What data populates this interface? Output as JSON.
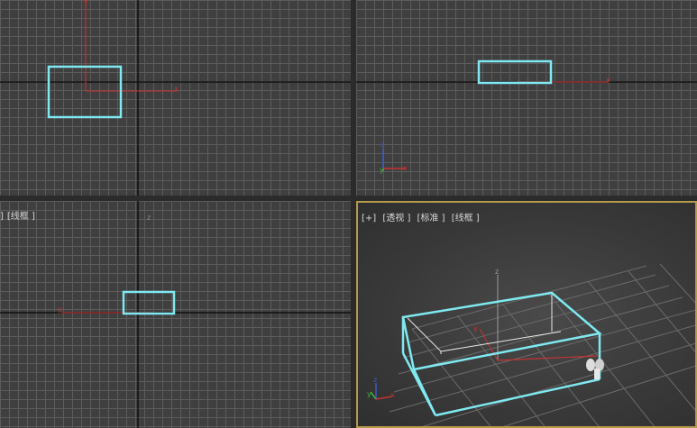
{
  "viewports": {
    "bottom_left": {
      "labels": [
        "]",
        "[线框 ]"
      ]
    },
    "perspective": {
      "labels": [
        "[+]",
        "[透视 ]",
        "[标准 ]",
        "[线框 ]"
      ]
    }
  },
  "axes": {
    "x": "x",
    "y": "y",
    "z": "z"
  },
  "colors": {
    "viewport_bg": "#3f3f3f",
    "grid": "#5c5c5c",
    "selection": "#7fe8f0",
    "axis_x": "#c83232",
    "axis_y": "#3cb43c",
    "axis_z": "#3c5ac8",
    "active_border": "#b59a4a"
  }
}
